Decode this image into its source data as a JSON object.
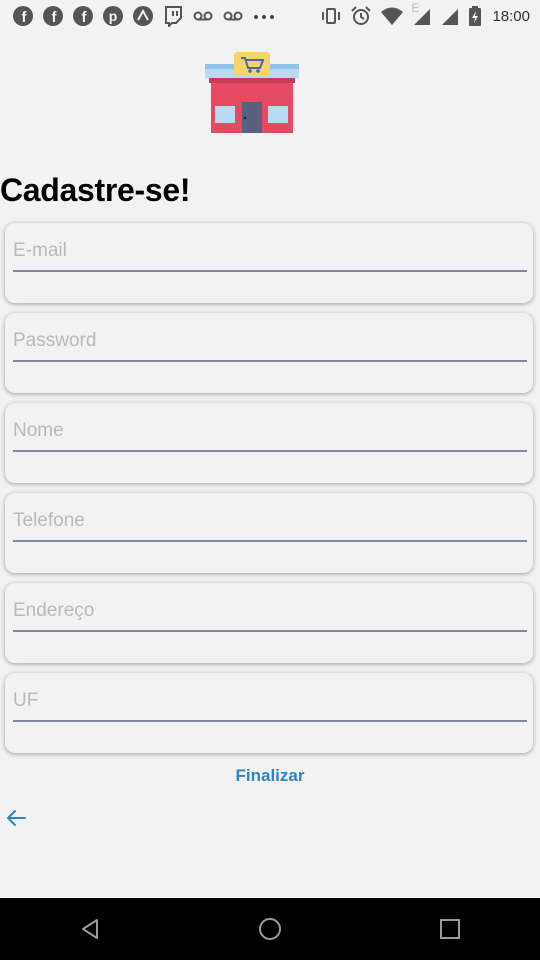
{
  "status_bar": {
    "time": "18:00",
    "network_label": "E",
    "left_icons": [
      "facebook-icon",
      "facebook-icon",
      "facebook-icon",
      "pinterest-icon",
      "astro-icon",
      "twitch-icon",
      "voicemail-icon",
      "voicemail-icon",
      "more-icon"
    ],
    "right_icons": [
      "vibrate-icon",
      "alarm-icon",
      "wifi-icon",
      "signal-icon",
      "signal-icon",
      "battery-icon"
    ]
  },
  "header": {
    "title": "Cadastre-se!"
  },
  "form": {
    "email_placeholder": "E-mail",
    "password_placeholder": "Password",
    "name_placeholder": "Nome",
    "phone_placeholder": "Telefone",
    "address_placeholder": "Endereço",
    "state_placeholder": "UF"
  },
  "actions": {
    "submit_label": "Finalizar"
  },
  "colors": {
    "accent": "#2f84c6",
    "background": "#f2f2f2",
    "underline": "#7f8aa0",
    "store_red": "#e64a62"
  }
}
